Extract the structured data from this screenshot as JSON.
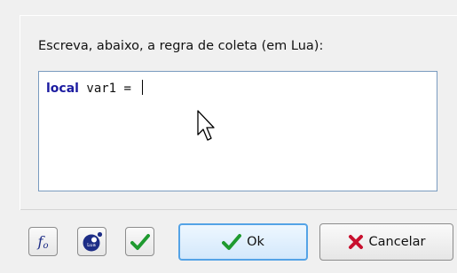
{
  "dialog": {
    "prompt": "Escreva, abaixo, a regra de coleta (em Lua):",
    "editor": {
      "keyword": "local",
      "code_rest": " var1 = "
    },
    "toolbar": {
      "function_icon": "function-icon",
      "lua_icon": "lua-logo-icon",
      "check_icon": "checkmark-icon"
    },
    "buttons": {
      "ok_label": "Ok",
      "cancel_label": "Cancelar"
    },
    "colors": {
      "keyword": "#1b1ba0",
      "ok_border": "#54a3e6",
      "check_green": "#1f9a2f",
      "cancel_red": "#c8102e"
    }
  }
}
